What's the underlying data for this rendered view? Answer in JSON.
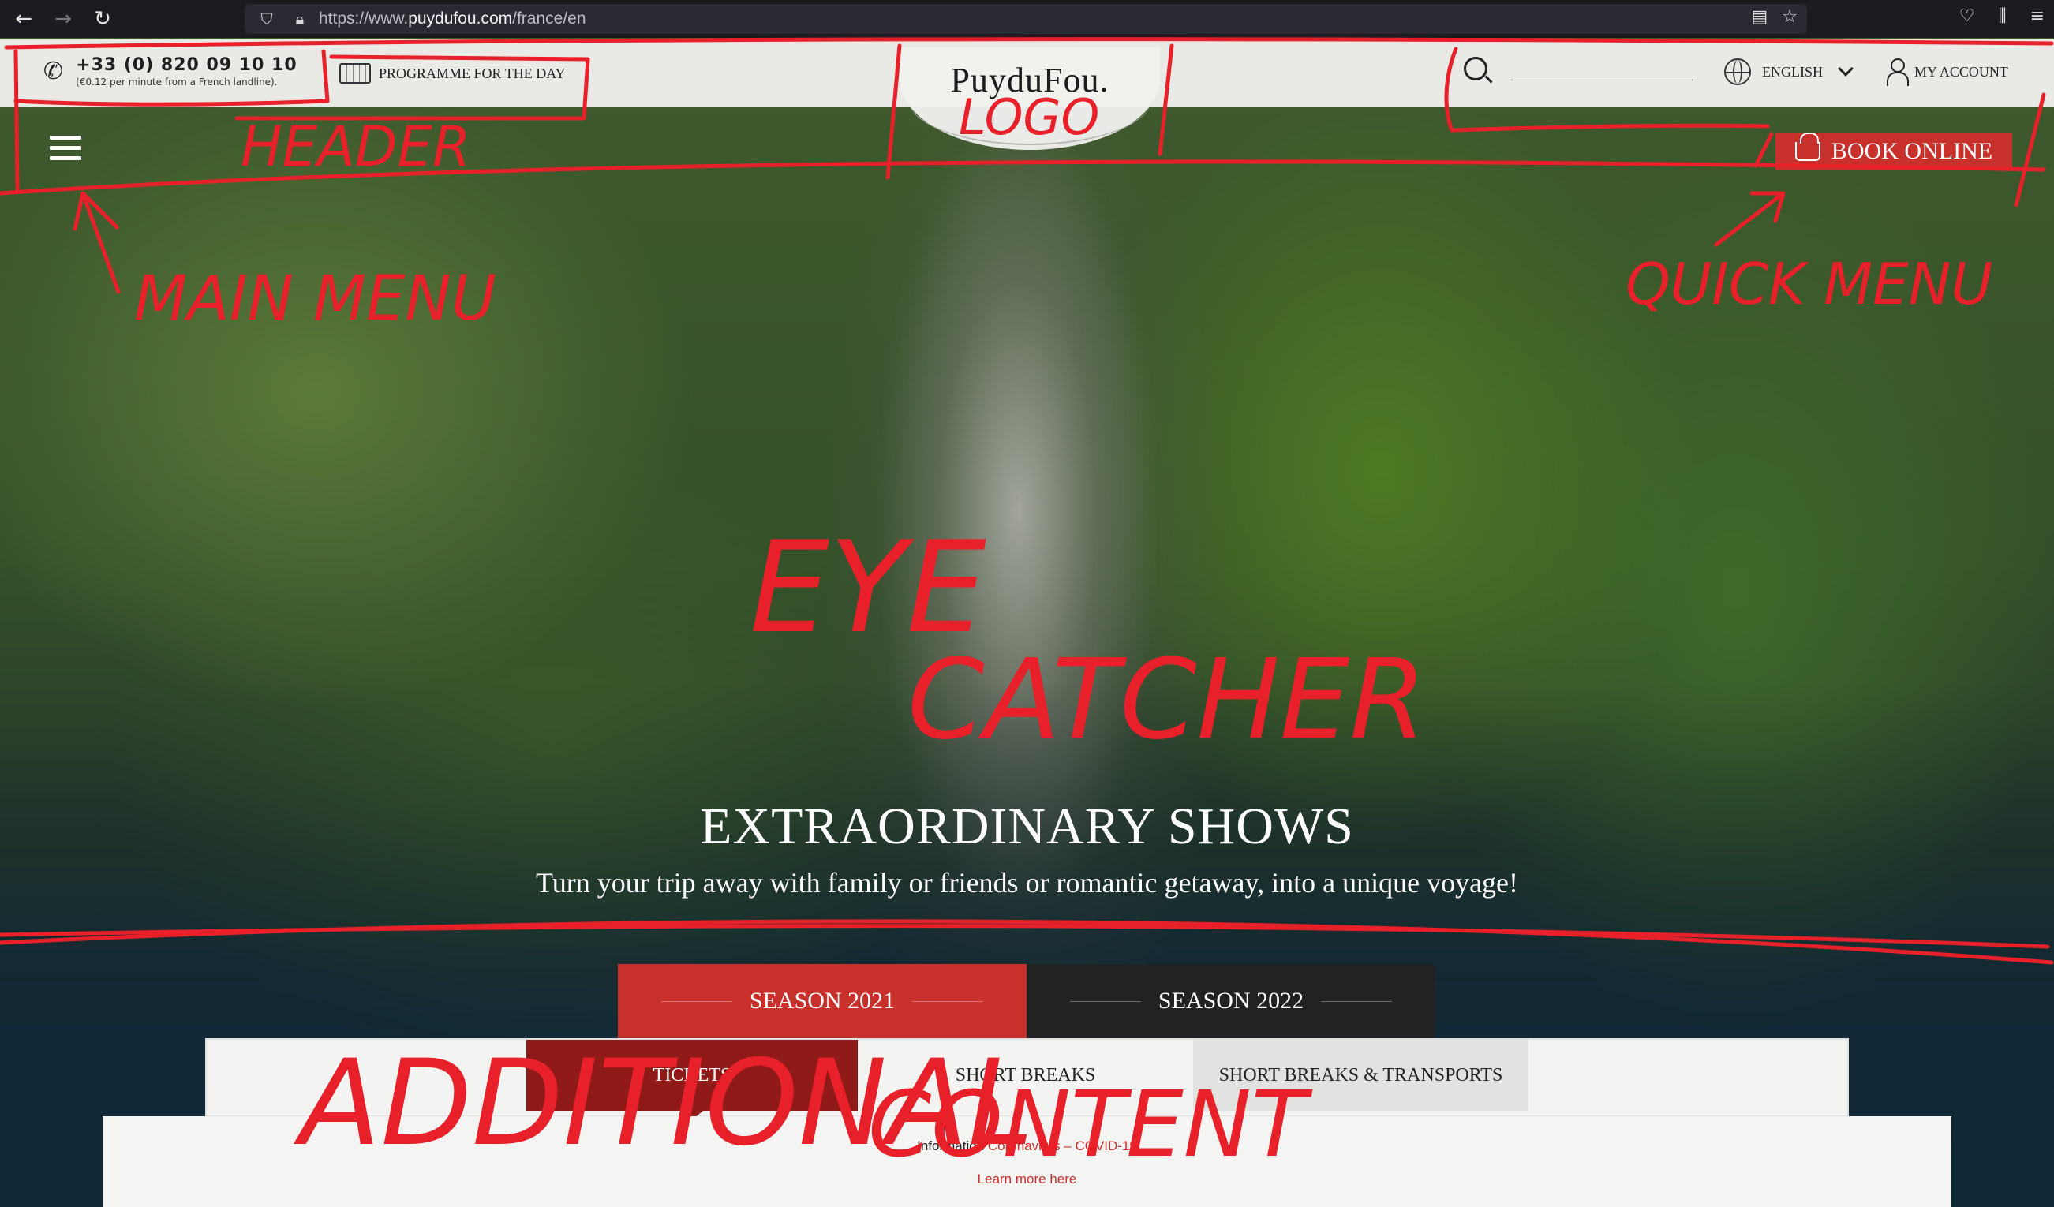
{
  "browser": {
    "url_prefix": "https://www.",
    "url_domain": "puydufou.com",
    "url_path": "/france/en"
  },
  "header": {
    "phone_number": "+33 (0) 820 09 10 10",
    "phone_note": "(€0.12 per minute from a French landline).",
    "programme_label": "PROGRAMME FOR THE DAY",
    "logo_text": "PuyduFou.",
    "search_placeholder": "",
    "language_label": "ENGLISH",
    "account_label": "MY ACCOUNT"
  },
  "quick_menu": {
    "book_label": "BOOK ONLINE"
  },
  "hero": {
    "title": "EXTRAORDINARY SHOWS",
    "subtitle": "Turn your trip away with family or friends or romantic getaway, into a unique voyage!"
  },
  "season_tabs": [
    {
      "label": "SEASON 2021",
      "active": true
    },
    {
      "label": "SEASON 2022",
      "active": false
    }
  ],
  "ticket_tabs": [
    {
      "label": "TICKETS"
    },
    {
      "label": "SHORT BREAKS"
    },
    {
      "label": "SHORT BREAKS & TRANSPORTS"
    }
  ],
  "info": {
    "prefix": "Information ",
    "highlight": "Coronavirus – COVID-19",
    "link": "Learn more here"
  },
  "annotations": {
    "header": "HEADER",
    "logo": "LOGO",
    "main_menu": "MAIN MENU",
    "quick_menu": "QUICK MENU",
    "eye_catcher_1": "EYE",
    "eye_catcher_2": "CATCHER",
    "additional_1": "ADDITIONAL",
    "additional_2": "CONTENT"
  },
  "colors": {
    "accent": "#c8302c",
    "annotation": "#e8202a",
    "dark_tab": "#222222"
  }
}
